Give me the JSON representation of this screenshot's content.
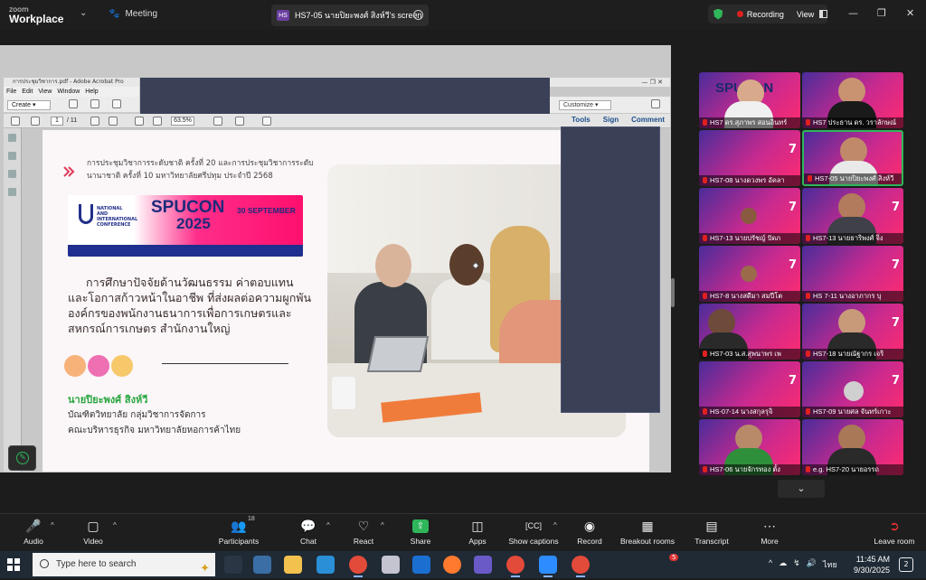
{
  "app": {
    "logo_line1": "zoom",
    "logo_line2": "Workplace",
    "meeting_label": "Meeting",
    "share_tab_badge": "HS",
    "share_tab_label": "HS7-05 นายปิยะพงศ์ สิงห์วี's screen",
    "recording_label": "Recording",
    "view_label": "View"
  },
  "acrobat": {
    "title": "การประชุมวิชาการ.pdf - Adobe Acrobat Pro",
    "menu": [
      "File",
      "Edit",
      "View",
      "Window",
      "Help"
    ],
    "create_label": "Create",
    "customize_label": "Customize",
    "page_current": "1",
    "page_total": "/ 11",
    "zoom": "63.5%",
    "tools_links": [
      "Tools",
      "Sign",
      "Comment"
    ]
  },
  "slide": {
    "conference_text": "การประชุมวิชาการระดับชาติ ครั้งที่ 20 และการประชุมวิชาการระดับนานาชาติ ครั้งที่ 10 มหาวิทยาลัยศรีปทุม ประจำปี 2568",
    "banner_org": "NATIONAL AND INTERNATIONAL CONFERENCE",
    "banner_spucon": "SPUCON",
    "banner_year": "2025",
    "banner_date": "30 SEPTEMBER",
    "title": "การศึกษาปัจจัยด้านวัฒนธรรม ค่าตอบแทนและโอกาสก้าวหน้าในอาชีพ ที่ส่งผลต่อความผูกพันองค์กรของพนักงานธนาการเพื่อการเกษตรและสหกรณ์การเกษตร สำนักงานใหญ่",
    "author": "นายปิยะพงศ์ สิงห์วี",
    "affiliation_line1": "บัณฑิตวิทยาลัย กลุ่มวิชาการจัดการ",
    "affiliation_line2": "คณะบริหารธุรกิจ มหาวิทยาลัยหอการค้าไทย",
    "dot_colors": [
      "#f7b27a",
      "#ef6fb3",
      "#f6c86a"
    ]
  },
  "gallery": {
    "room_number": "7",
    "tiles": [
      {
        "name": "HS7 ดร.สุภาพร สอนอินทร์"
      },
      {
        "name": "HS7 ประธาน ดร. วราลักษณ์"
      },
      {
        "name": "HS7-08 นางดวงพร อัคลา"
      },
      {
        "name": "HS7-05 นายปิยะพงศ์ สิงห์วี"
      },
      {
        "name": "HS7-13 นายปรัชญ์ ปัดภ"
      },
      {
        "name": "HS7-13 นายธาริพงศ์ จิ่ง"
      },
      {
        "name": "HS7-8 นางสดีมา สมปีโต"
      },
      {
        "name": "HS 7-11 นางอาภากร บุ"
      },
      {
        "name": "HS7-03 น.ส.สุพนาพร เพ"
      },
      {
        "name": "HS7-18 นายณัฐากร เจริ"
      },
      {
        "name": "HS-07-14 นางสกุลรุจิ"
      },
      {
        "name": "HS7-09 นายศล จันทร์เกาะ"
      },
      {
        "name": "HS7-06 นายจักรทอง ตั้ง"
      },
      {
        "name": "e.g. HS7-20 นายอรรถ"
      }
    ]
  },
  "controls": {
    "audio": "Audio",
    "video": "Video",
    "participants": "Participants",
    "participants_count": "18",
    "chat": "Chat",
    "react": "React",
    "share": "Share",
    "apps": "Apps",
    "captions": "Show captions",
    "record": "Record",
    "breakout": "Breakout rooms",
    "transcript": "Transcript",
    "more": "More",
    "leave": "Leave room"
  },
  "taskbar": {
    "search_placeholder": "Type here to search",
    "language": "ไทย",
    "time": "11:45 AM",
    "date": "9/30/2025",
    "notification_count": "2",
    "teams_badge": "5"
  }
}
